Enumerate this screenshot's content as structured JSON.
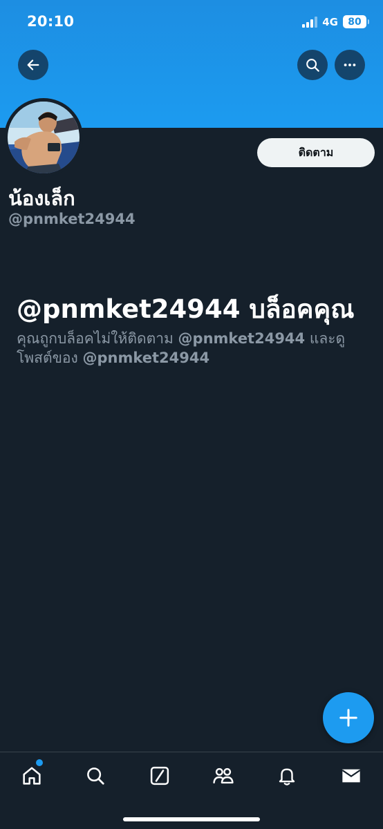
{
  "status_bar": {
    "time": "20:10",
    "network": "4G",
    "battery": "80"
  },
  "header": {
    "back_icon": "arrow-left-icon",
    "search_icon": "search-icon",
    "more_icon": "more-horizontal-icon",
    "banner_color": "#1d9bf0"
  },
  "profile": {
    "display_name": "น้องเล็ก",
    "handle": "@pnmket24944",
    "follow_label": "ติดตาม"
  },
  "blocked": {
    "title": "@pnmket24944 บล็อคคุณ",
    "message_part1": "คุณถูกบล็อคไม่ให้ติดตาม ",
    "message_handle1": "@pnmket24944",
    "message_part2": " และดูโพสต์ของ ",
    "message_handle2": "@pnmket24944"
  },
  "fab": {
    "icon": "plus-icon"
  },
  "bottom_nav": {
    "items": [
      {
        "name": "home",
        "icon": "home-icon",
        "has_notification_dot": true
      },
      {
        "name": "explore",
        "icon": "search-icon"
      },
      {
        "name": "grok",
        "icon": "slash-box-icon"
      },
      {
        "name": "communities",
        "icon": "people-icon"
      },
      {
        "name": "notifications",
        "icon": "bell-icon"
      },
      {
        "name": "messages",
        "icon": "envelope-icon"
      }
    ]
  },
  "colors": {
    "background": "#15202b",
    "accent": "#1d9bf0",
    "secondary_text": "#8b98a5",
    "button_bg": "#eff3f4"
  }
}
